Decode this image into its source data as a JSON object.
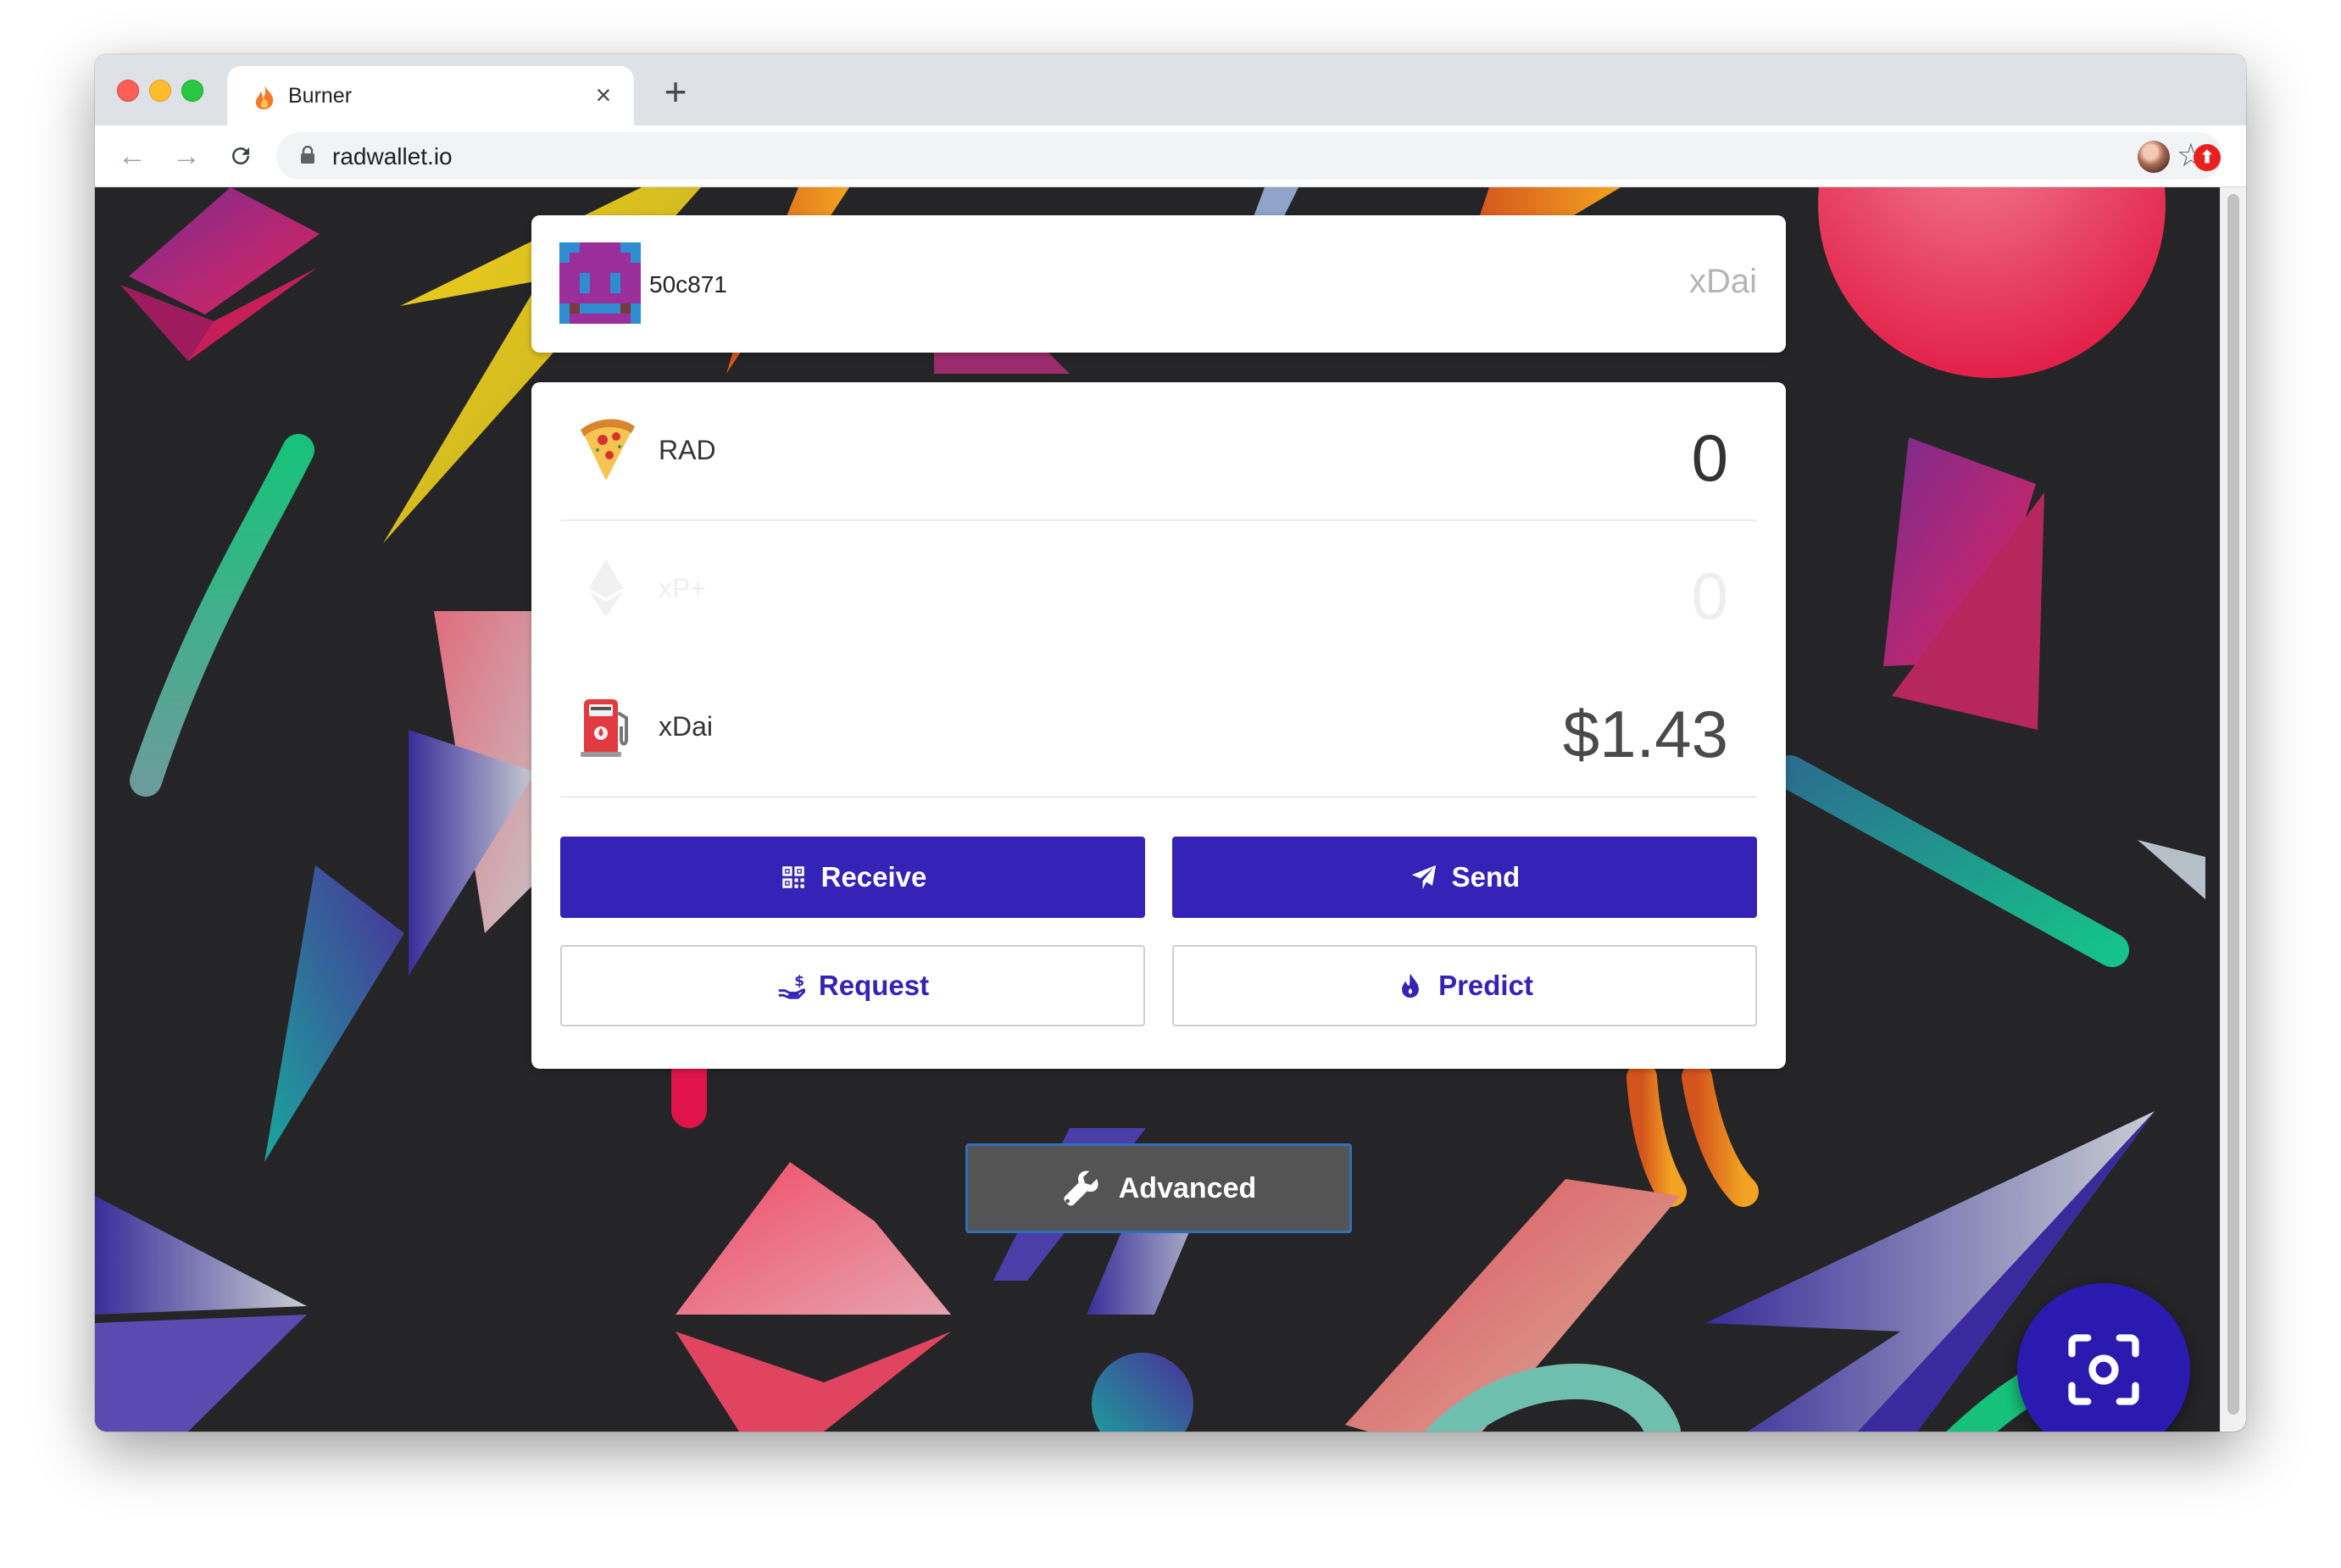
{
  "browser": {
    "tab_title": "Burner",
    "url": "radwallet.io"
  },
  "wallet": {
    "address_short": "50c871",
    "network": "xDai",
    "assets": [
      {
        "icon": "pizza-icon",
        "name": "RAD",
        "value": "0"
      },
      {
        "icon": "eth-icon",
        "name": "xP+",
        "value": "0"
      },
      {
        "icon": "fuel-pump-icon",
        "name": "xDai",
        "value": "$1.43"
      }
    ],
    "actions": {
      "receive": "Receive",
      "send": "Send",
      "request": "Request",
      "predict": "Predict"
    },
    "advanced_label": "Advanced"
  },
  "colors": {
    "primary": "#3522b6",
    "background": "#252527",
    "advanced_button": "#545454"
  }
}
